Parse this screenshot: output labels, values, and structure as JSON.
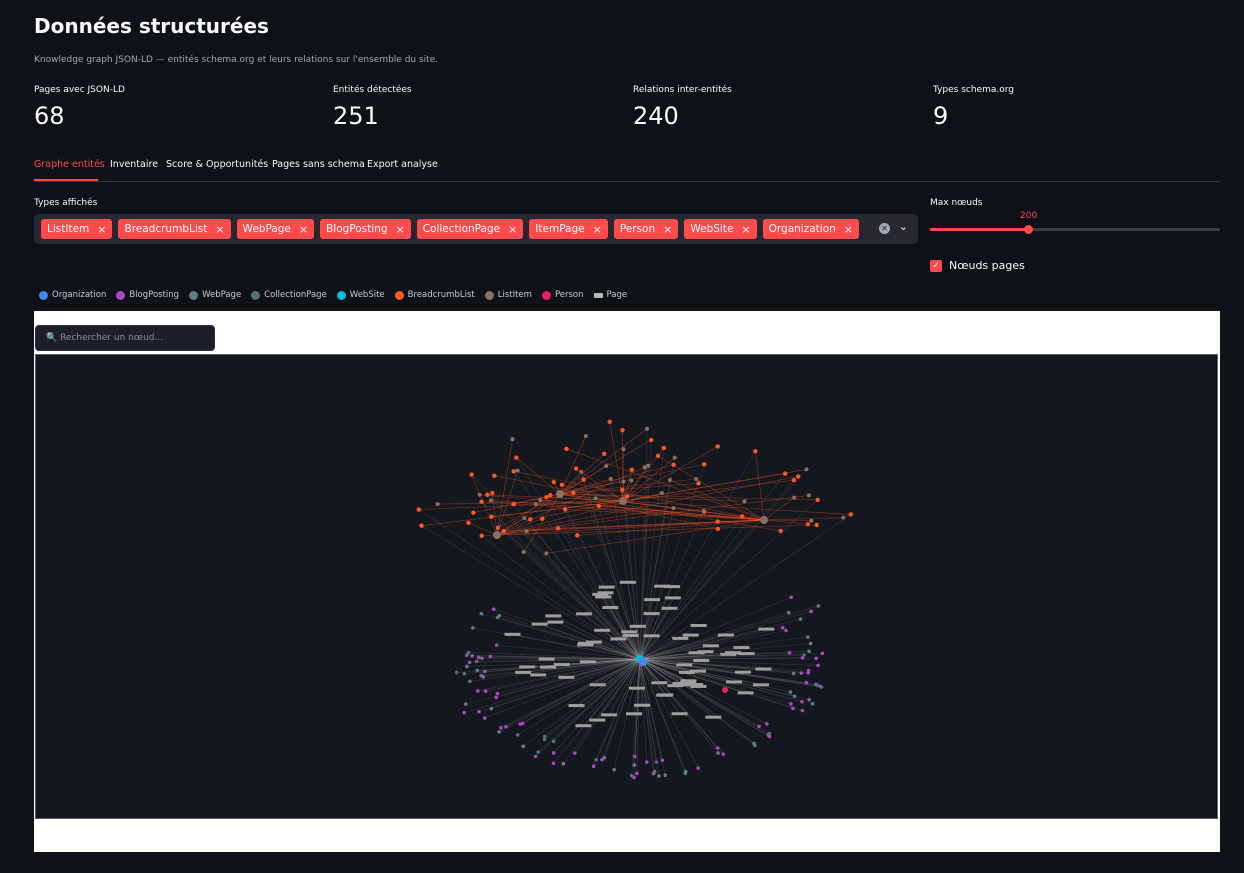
{
  "header": {
    "title": "Données structurées",
    "subtitle": "Knowledge graph JSON-LD — entités schema.org et leurs relations sur l'ensemble du site."
  },
  "metrics": [
    {
      "label": "Pages avec JSON-LD",
      "value": "68"
    },
    {
      "label": "Entités détectées",
      "value": "251"
    },
    {
      "label": "Relations inter-entités",
      "value": "240"
    },
    {
      "label": "Types schema.org",
      "value": "9"
    }
  ],
  "tabs": [
    {
      "label": "Graphe entités",
      "active": true
    },
    {
      "label": "Inventaire"
    },
    {
      "label": "Score & Opportunités"
    },
    {
      "label": "Pages sans schema"
    },
    {
      "label": "Export analyse"
    }
  ],
  "filters": {
    "types_label": "Types affichés",
    "chips": [
      "ListItem",
      "BreadcrumbList",
      "WebPage",
      "BlogPosting",
      "CollectionPage",
      "ItemPage",
      "Person",
      "WebSite",
      "Organization"
    ],
    "max_nodes_label": "Max nœuds",
    "max_nodes_value": "200",
    "max_nodes_fraction": 0.34,
    "page_nodes_label": "Nœuds pages",
    "page_nodes_checked": true
  },
  "legend": [
    {
      "label": "Organization",
      "color": "#4285f4"
    },
    {
      "label": "BlogPosting",
      "color": "#ab47bc"
    },
    {
      "label": "WebPage",
      "color": "#607d8b"
    },
    {
      "label": "CollectionPage",
      "color": "#546e7a"
    },
    {
      "label": "WebSite",
      "color": "#00bcd4"
    },
    {
      "label": "BreadcrumbList",
      "color": "#ff5722"
    },
    {
      "label": "ListItem",
      "color": "#8d6e63"
    },
    {
      "label": "Person",
      "color": "#e91e63"
    },
    {
      "label": "Page",
      "shape": "rect",
      "color": "#bbbbbb"
    }
  ],
  "graph": {
    "search_placeholder": "🔍 Rechercher un nœud..."
  }
}
